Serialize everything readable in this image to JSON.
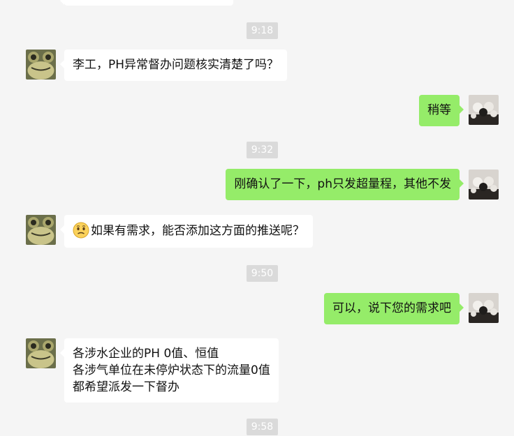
{
  "messages": {
    "t1": "9:18",
    "m1": "李工，PH异常督办问题核实清楚了吗？",
    "m2": "稍等",
    "t2": "9:32",
    "m3": "刚确认了一下，ph只发超量程，其他不发",
    "m4": "如果有需求，能否添加这方面的推送呢？",
    "t3": "9:50",
    "m5": "可以，说下您的需求吧",
    "m6": {
      "line1": "各涉水企业的PH 0值、恒值",
      "line2": "各涉气单位在未停炉状态下的流量0值",
      "line3": "都希望派发一下督办"
    },
    "t4": "9:58"
  },
  "avatars": {
    "incoming": "frog-avatar",
    "outgoing": "figures-avatar"
  },
  "emoji": "worried-face-emoji",
  "colors": {
    "background": "#f5f5f5",
    "incoming_bubble": "#ffffff",
    "outgoing_bubble": "#95ec69",
    "timestamp_bg": "#dadada"
  }
}
